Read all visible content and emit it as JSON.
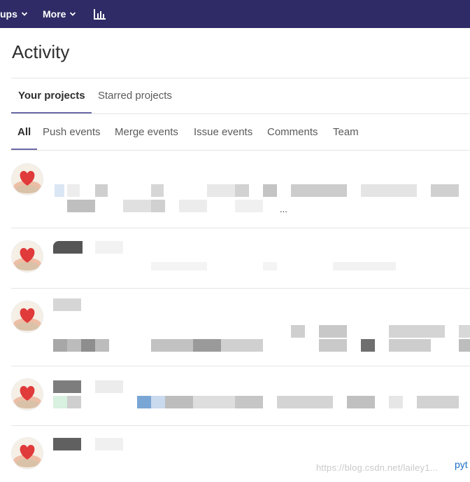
{
  "topbar": {
    "groups_label": "ups",
    "more_label": "More",
    "background": "#2f2b66"
  },
  "page": {
    "title": "Activity"
  },
  "project_tabs": [
    {
      "label": "Your projects",
      "active": true
    },
    {
      "label": "Starred projects",
      "active": false
    }
  ],
  "event_filters": [
    {
      "label": "All",
      "active": true
    },
    {
      "label": "Push events",
      "active": false
    },
    {
      "label": "Merge events",
      "active": false
    },
    {
      "label": "Issue events",
      "active": false
    },
    {
      "label": "Comments",
      "active": false
    },
    {
      "label": "Team",
      "active": false
    }
  ],
  "events": {
    "row1_ellipsis": "..."
  },
  "footer": {
    "watermark": "https://blog.csdn.net/lailey1...",
    "link_partial": "pyt"
  },
  "colors": {
    "accent": "#6b6aa8",
    "link": "#1f6fc4"
  }
}
